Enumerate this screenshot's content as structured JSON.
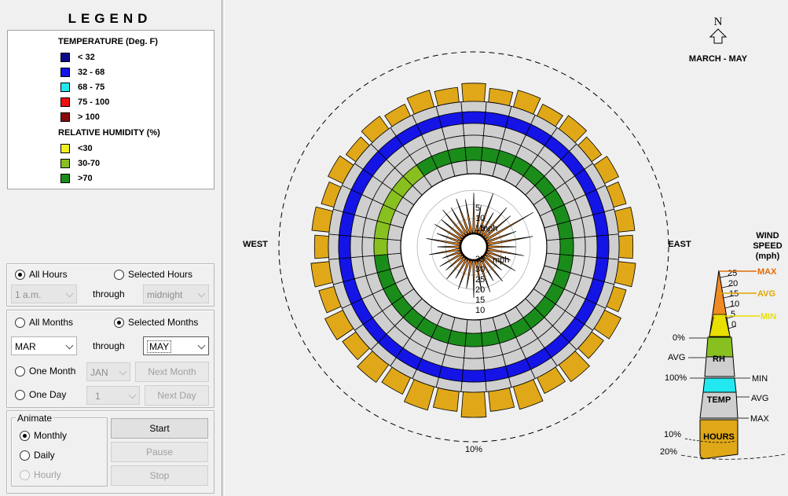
{
  "legend": {
    "title": "LEGEND",
    "temperature_heading": "TEMPERATURE (Deg. F)",
    "temperature_items": [
      {
        "label": "< 32",
        "color": "#0a0a8a"
      },
      {
        "label": "32  -  68",
        "color": "#1414e6"
      },
      {
        "label": "68  -  75",
        "color": "#22e8f0"
      },
      {
        "label": "75  -  100",
        "color": "#ee1111"
      },
      {
        "label": "> 100",
        "color": "#8a0a0a"
      }
    ],
    "humidity_heading": "RELATIVE HUMIDITY (%)",
    "humidity_items": [
      {
        "label": "<30",
        "color": "#f0f020"
      },
      {
        "label": "30-70",
        "color": "#88c020"
      },
      {
        "label": ">70",
        "color": "#1a8c1a"
      }
    ]
  },
  "hours": {
    "all_hours_label": "All Hours",
    "selected_hours_label": "Selected Hours",
    "from_value": "1 a.m.",
    "through_label": "through",
    "to_value": "midnight"
  },
  "months": {
    "all_months_label": "All Months",
    "selected_months_label": "Selected Months",
    "from_value": "MAR",
    "through_label": "through",
    "to_value": "MAY",
    "one_month_label": "One Month",
    "one_month_value": "JAN",
    "next_month_label": "Next Month",
    "one_day_label": "One Day",
    "one_day_value": "1",
    "next_day_label": "Next Day"
  },
  "animate": {
    "group_label": "Animate",
    "monthly_label": "Monthly",
    "daily_label": "Daily",
    "hourly_label": "Hourly",
    "start_label": "Start",
    "pause_label": "Pause",
    "stop_label": "Stop"
  },
  "chart": {
    "north_label": "N",
    "period_label": "MARCH - MAY",
    "west_label": "WEST",
    "east_label": "EAST",
    "outer_circle_label": "10%",
    "speed_unit_top": "mph",
    "speed_unit_bottom": "mph",
    "speed_ticks_top": [
      "5",
      "10",
      "15"
    ],
    "speed_ticks_bottom": [
      "35",
      "30",
      "25",
      "20",
      "15",
      "10"
    ],
    "key": {
      "wind_speed_label": "WIND\nSPEED\n(mph)",
      "max_label": "MAX",
      "avg_label": "AVG",
      "min_label": "MIN",
      "speed_values": [
        "25",
        "20",
        "15",
        "10",
        "5",
        "0"
      ],
      "rh_pct_top": "0%",
      "rh_avg": "AVG",
      "rh_label": "RH",
      "rh_pct_bottom": "100%",
      "temp_min": "MIN",
      "temp_label": "TEMP",
      "temp_avg": "AVG",
      "temp_max": "MAX",
      "hours_label": "HOURS",
      "hours_pct_1": "10%",
      "hours_pct_2": "20%"
    },
    "colors": {
      "hours": "#e0a818",
      "wind": "#f08a24",
      "grey": "#cfcfcf",
      "temp": "#1414e6",
      "rh": "#1a8c1a",
      "rh_light": "#88c020",
      "key_max": "#e06b0a",
      "key_avg": "#e2a400",
      "key_min": "#e8e000",
      "key_rh": "#88c020",
      "key_temp": "#22e8f0"
    }
  }
}
